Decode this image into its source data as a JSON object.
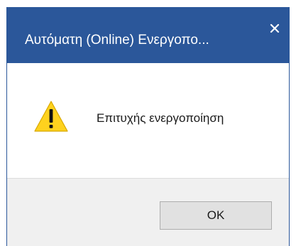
{
  "dialog": {
    "title": "Αυτόματη (Online) Ενεργοπο...",
    "message": "Επιτυχής ενεργοποίηση",
    "ok_label": "OK",
    "icons": {
      "close": "close-icon",
      "warning": "warning-icon"
    },
    "colors": {
      "titlebar": "#2b579a",
      "warning_fill": "#ffd21e",
      "button_bg": "#e1e1e1"
    }
  }
}
